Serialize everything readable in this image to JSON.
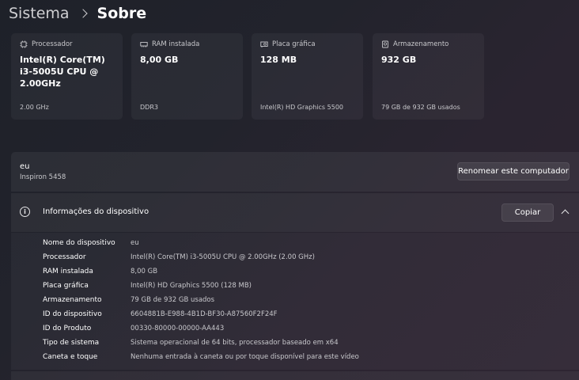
{
  "breadcrumb": {
    "parent": "Sistema",
    "current": "Sobre"
  },
  "cards": [
    {
      "label": "Processador",
      "value": "Intel(R) Core(TM) i3-5005U CPU @ 2.00GHz",
      "sub": "2.00 GHz",
      "icon": "processor-icon"
    },
    {
      "label": "RAM instalada",
      "value": "8,00 GB",
      "sub": "DDR3",
      "icon": "ram-icon"
    },
    {
      "label": "Placa gráfica",
      "value": "128 MB",
      "sub": "Intel(R) HD Graphics 5500",
      "icon": "graphics-card-icon"
    },
    {
      "label": "Armazenamento",
      "value": "932 GB",
      "sub": "79 GB de 932 GB usados",
      "icon": "storage-icon"
    }
  ],
  "device": {
    "name": "eu",
    "model": "Inspiron 5458",
    "rename_label": "Renomear este computador"
  },
  "info": {
    "title": "Informações do dispositivo",
    "copy_label": "Copiar",
    "rows": [
      {
        "label": "Nome do dispositivo",
        "value": "eu"
      },
      {
        "label": "Processador",
        "value": "Intel(R) Core(TM) i3-5005U CPU @ 2.00GHz (2.00 GHz)"
      },
      {
        "label": "RAM instalada",
        "value": "8,00 GB"
      },
      {
        "label": "Placa gráfica",
        "value": "Intel(R) HD Graphics 5500 (128 MB)"
      },
      {
        "label": "Armazenamento",
        "value": "79 GB de 932 GB usados"
      },
      {
        "label": "ID do dispositivo",
        "value": "6604881B-E988-4B1D-BF30-A87560F2F24F"
      },
      {
        "label": "ID do Produto",
        "value": "00330-80000-00000-AA443"
      },
      {
        "label": "Tipo de sistema",
        "value": "Sistema operacional de 64 bits, processador baseado em x64"
      },
      {
        "label": "Caneta e toque",
        "value": "Nenhuma entrada à caneta ou por toque disponível para este vídeo"
      }
    ]
  },
  "colors": {
    "background": "#22232c",
    "card": "#2a2b33",
    "text_primary": "#ffffff",
    "text_secondary": "#c8c8cc"
  }
}
